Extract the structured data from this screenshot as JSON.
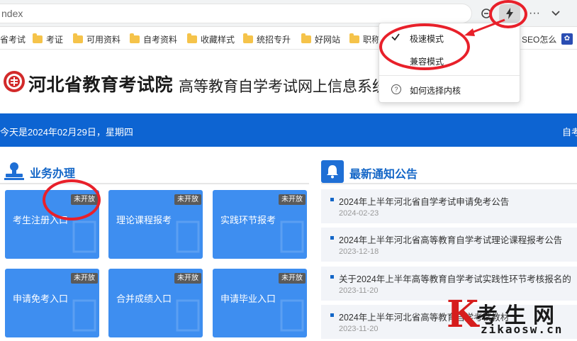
{
  "address_bar": {
    "url_text": "ndex"
  },
  "bookmarks": [
    {
      "label": "省考试",
      "icon": "none"
    },
    {
      "label": "考证",
      "icon": "folder-icon"
    },
    {
      "label": "可用资料",
      "icon": "folder-icon"
    },
    {
      "label": "自考资料",
      "icon": "folder-icon"
    },
    {
      "label": "收藏样式",
      "icon": "folder-icon"
    },
    {
      "label": "统招专升",
      "icon": "folder-icon"
    },
    {
      "label": "好网站",
      "icon": "folder-icon"
    },
    {
      "label": "职称",
      "icon": "folder-icon"
    },
    {
      "label": "SEO怎么",
      "icon": "none"
    },
    {
      "label": "",
      "icon": "paw-icon"
    }
  ],
  "header": {
    "site_name": "河北省教育考试院",
    "site_subtitle": "高等教育自学考试网上信息系统"
  },
  "date_bar": {
    "date_text": "今天是2024年02月29日，星期四",
    "right_text": "自考"
  },
  "business": {
    "title": "业务办理",
    "tiles": [
      {
        "label": "考生注册入口",
        "badge": "未开放"
      },
      {
        "label": "理论课程报考",
        "badge": "未开放"
      },
      {
        "label": "实践环节报考",
        "badge": "未开放"
      },
      {
        "label": "申请免考入口",
        "badge": "未开放"
      },
      {
        "label": "合并成绩入口",
        "badge": "未开放"
      },
      {
        "label": "申请毕业入口",
        "badge": "未开放"
      }
    ]
  },
  "notices": {
    "title": "最新通知公告",
    "items": [
      {
        "title": "2024年上半年河北省自学考试申请免考公告",
        "date": "2024-02-23"
      },
      {
        "title": "2024年上半年河北省高等教育自学考试理论课程报考公告",
        "date": "2023-12-18"
      },
      {
        "title": "关于2024年上半年高等教育自学考试实践性环节考核报名的",
        "date": "2023-11-20"
      },
      {
        "title": "2024年上半年河北省高等教育自学考试教材",
        "date": "2023-11-20"
      }
    ]
  },
  "kernel_menu": {
    "items": [
      {
        "label": "极速模式",
        "checked": true
      },
      {
        "label": "兼容模式",
        "checked": false
      }
    ],
    "help_label": "如何选择内核"
  },
  "watermark": {
    "letter": "K",
    "cn": "考生网",
    "en": "zikaosw.cn"
  },
  "colors": {
    "brand_blue": "#0d64d2",
    "tile_blue": "#3e8ef0",
    "annotation_red": "#e8202a",
    "seal_red": "#d22a2a"
  }
}
